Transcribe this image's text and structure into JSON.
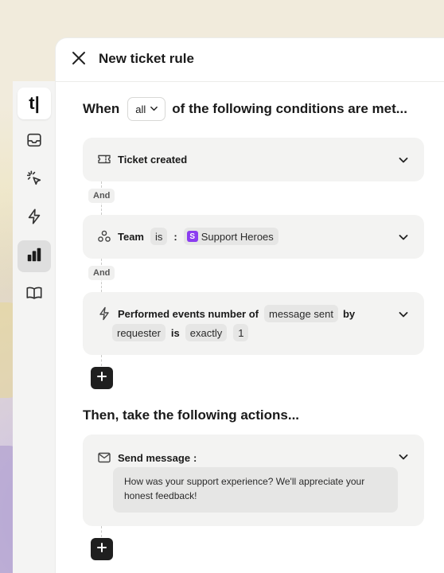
{
  "rail": {
    "logo_text": "t|",
    "items": [
      {
        "icon": "inbox-icon"
      },
      {
        "icon": "pointer-click-icon"
      },
      {
        "icon": "lightning-icon"
      },
      {
        "icon": "bar-chart-icon",
        "active": true
      },
      {
        "icon": "book-icon"
      }
    ]
  },
  "header": {
    "title": "New ticket rule"
  },
  "when": {
    "prefix": "When",
    "select_value": "all",
    "suffix": "of the following conditions are met..."
  },
  "conditions": [
    {
      "icon": "ticket-icon",
      "label": "Ticket created"
    },
    {
      "icon": "team-icon",
      "label": "Team",
      "operator": "is",
      "separator": ":",
      "badge": "S",
      "value": "Support Heroes"
    },
    {
      "icon": "lightning-icon",
      "label": "Performed events number of",
      "event": "message sent",
      "by": "by",
      "actor": "requester",
      "is": "is",
      "match": "exactly",
      "count": "1"
    }
  ],
  "connector_label": "And",
  "then_title": "Then, take the following actions...",
  "actions": [
    {
      "icon": "mail-icon",
      "label": "Send message",
      "colon": ":",
      "message": "How was your support experience? We'll appreciate your honest feedback!"
    }
  ],
  "colors": {
    "badge": "#8b3df0",
    "plus_button": "#1f1f1f",
    "card": "#f3f3f2"
  }
}
